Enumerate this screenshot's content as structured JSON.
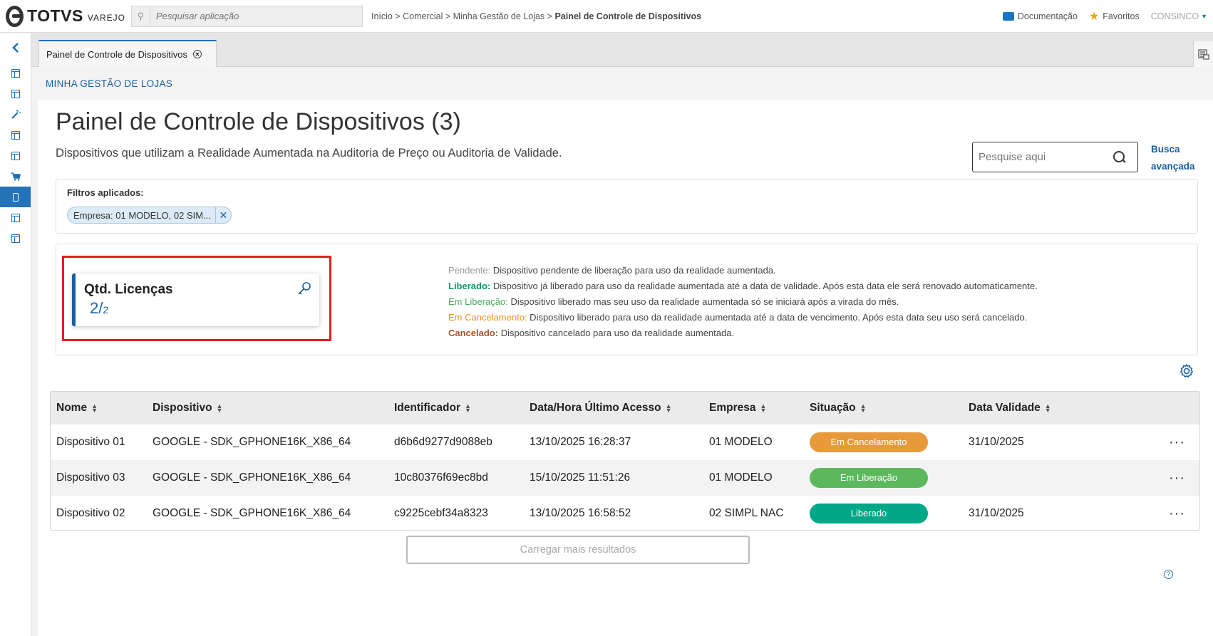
{
  "brand": {
    "name": "TOTVS",
    "sub": "VAREJO"
  },
  "search_app": {
    "placeholder": "Pesquisar aplicação"
  },
  "breadcrumb": {
    "path": "Início > Comercial > Minha Gestão de Lojas > ",
    "current": "Painel de Controle de Dispositivos"
  },
  "top_links": {
    "docs": "Documentação",
    "favorites": "Favoritos",
    "user": "CONSINCO"
  },
  "tab": {
    "label": "Painel de Controle de Dispositivos"
  },
  "section": "MINHA GESTÃO DE LOJAS",
  "page": {
    "title": "Painel de Controle de Dispositivos (3)",
    "subtitle": "Dispositivos que utilizam a Realidade Aumentada na Auditoria de Preço ou Auditoria de Validade."
  },
  "search": {
    "placeholder": "Pesquise aqui",
    "advanced_line1": "Busca",
    "advanced_line2": "avançada"
  },
  "filters": {
    "label": "Filtros aplicados:",
    "chip": "Empresa: 01 MODELO, 02 SIM..."
  },
  "card": {
    "title": "Qtd. Licenças",
    "used": "2/",
    "total": "2"
  },
  "legend": [
    {
      "term": "Pendente:",
      "desc": " Dispositivo pendente de liberação para uso da realidade aumentada."
    },
    {
      "term": "Liberado:",
      "desc": " Dispositivo já liberado para uso da realidade aumentada até a data de validade. Após esta data ele será renovado automaticamente."
    },
    {
      "term": "Em Liberação:",
      "desc": " Dispositivo liberado mas seu uso da realidade aumentada só se iniciará após a virada do mês."
    },
    {
      "term": "Em Cancelamento:",
      "desc": " Dispositivo liberado para uso da realidade aumentada até a data de vencimento. Após esta data seu uso será cancelado."
    },
    {
      "term": "Cancelado:",
      "desc": " Dispositivo cancelado para uso da realidade aumentada."
    }
  ],
  "table": {
    "headers": [
      "Nome",
      "Dispositivo",
      "Identificador",
      "Data/Hora Último Acesso",
      "Empresa",
      "Situação",
      "Data Validade"
    ],
    "rows": [
      {
        "nome": "Dispositivo 01",
        "dispositivo": "GOOGLE - SDK_GPHONE16K_X86_64",
        "id": "d6b6d9277d9088eb",
        "acesso": "13/10/2025 16:28:37",
        "empresa": "01 MODELO",
        "situacao": "Em Cancelamento",
        "validade": "31/10/2025"
      },
      {
        "nome": "Dispositivo 03",
        "dispositivo": "GOOGLE - SDK_GPHONE16K_X86_64",
        "id": "10c80376f69ec8bd",
        "acesso": "15/10/2025 11:51:26",
        "empresa": "01 MODELO",
        "situacao": "Em Liberação",
        "validade": ""
      },
      {
        "nome": "Dispositivo 02",
        "dispositivo": "GOOGLE - SDK_GPHONE16K_X86_64",
        "id": "c9225cebf34a8323",
        "acesso": "13/10/2025 16:58:52",
        "empresa": "02 SIMPL NAC",
        "situacao": "Liberado",
        "validade": "31/10/2025"
      }
    ]
  },
  "status_colors": {
    "em_cancelamento": "#e8993a",
    "em_liberacao": "#5cb85c",
    "liberado": "#00a887"
  },
  "load_more": "Carregar mais resultados"
}
